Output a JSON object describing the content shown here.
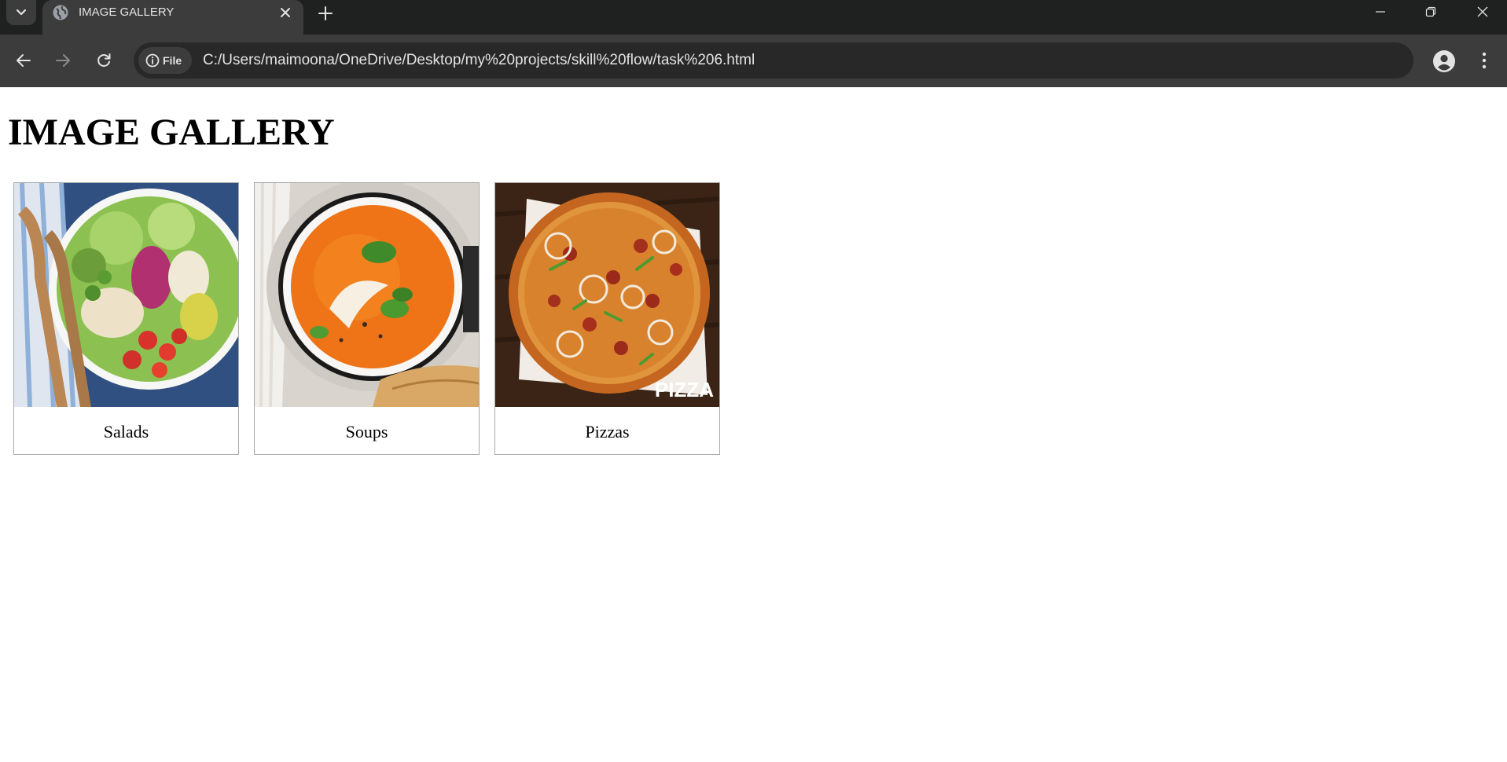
{
  "browser": {
    "tab": {
      "title": "IMAGE GALLERY"
    },
    "address": {
      "chip_label": "File",
      "url": "C:/Users/maimoona/OneDrive/Desktop/my%20projects/skill%20flow/task%206.html"
    },
    "icons": [
      "tab-search-chevron",
      "globe-favicon",
      "close-x",
      "plus",
      "minimize",
      "restore",
      "close-window",
      "back-arrow",
      "forward-arrow",
      "reload",
      "info",
      "star",
      "profile",
      "kebab-menu"
    ],
    "colors": {
      "frame": "#1f2020",
      "toolbar": "#3c3c3c",
      "omnibox": "#282828",
      "text": "#e3e3e3"
    }
  },
  "page": {
    "title": "IMAGE GALLERY",
    "gallery": {
      "items": [
        {
          "caption": "Salads",
          "image": "salad-bowl"
        },
        {
          "caption": "Soups",
          "image": "tomato-soup-bowl"
        },
        {
          "caption": "Pizzas",
          "image": "pizza",
          "image_text": "PIZZA"
        }
      ]
    }
  }
}
